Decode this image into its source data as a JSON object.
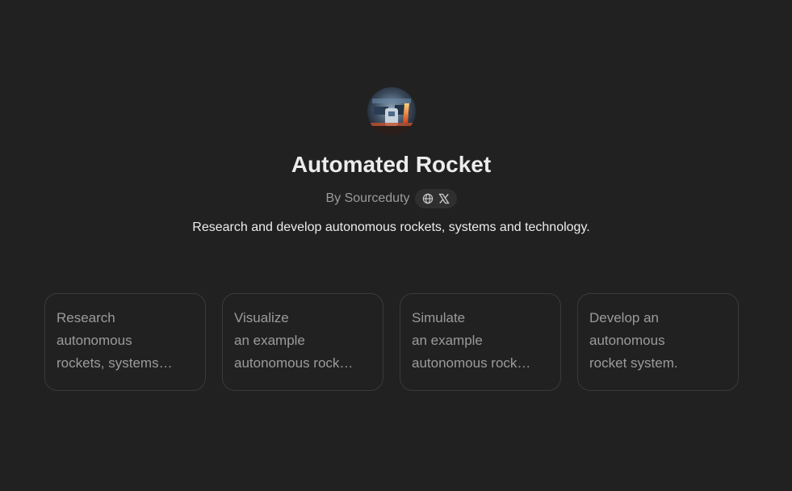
{
  "gpt": {
    "name": "Automated Rocket",
    "byline": "By Sourceduty",
    "description": "Research and develop autonomous rockets, systems and technology."
  },
  "links": {
    "icons": [
      "globe-icon",
      "x-logo-icon"
    ]
  },
  "starters": [
    {
      "lines": [
        "Research",
        "autonomous",
        "rockets, systems…"
      ]
    },
    {
      "lines": [
        "Visualize",
        "an example",
        "autonomous rock…"
      ]
    },
    {
      "lines": [
        "Simulate",
        "an example",
        "autonomous rock…"
      ]
    },
    {
      "lines": [
        "Develop an",
        "autonomous",
        "rocket system."
      ]
    }
  ],
  "colors": {
    "background": "#212121",
    "title": "#ececec",
    "muted": "#9b9b9b",
    "card_border": "#3a3a3a",
    "pill": "#2f2f2f"
  }
}
